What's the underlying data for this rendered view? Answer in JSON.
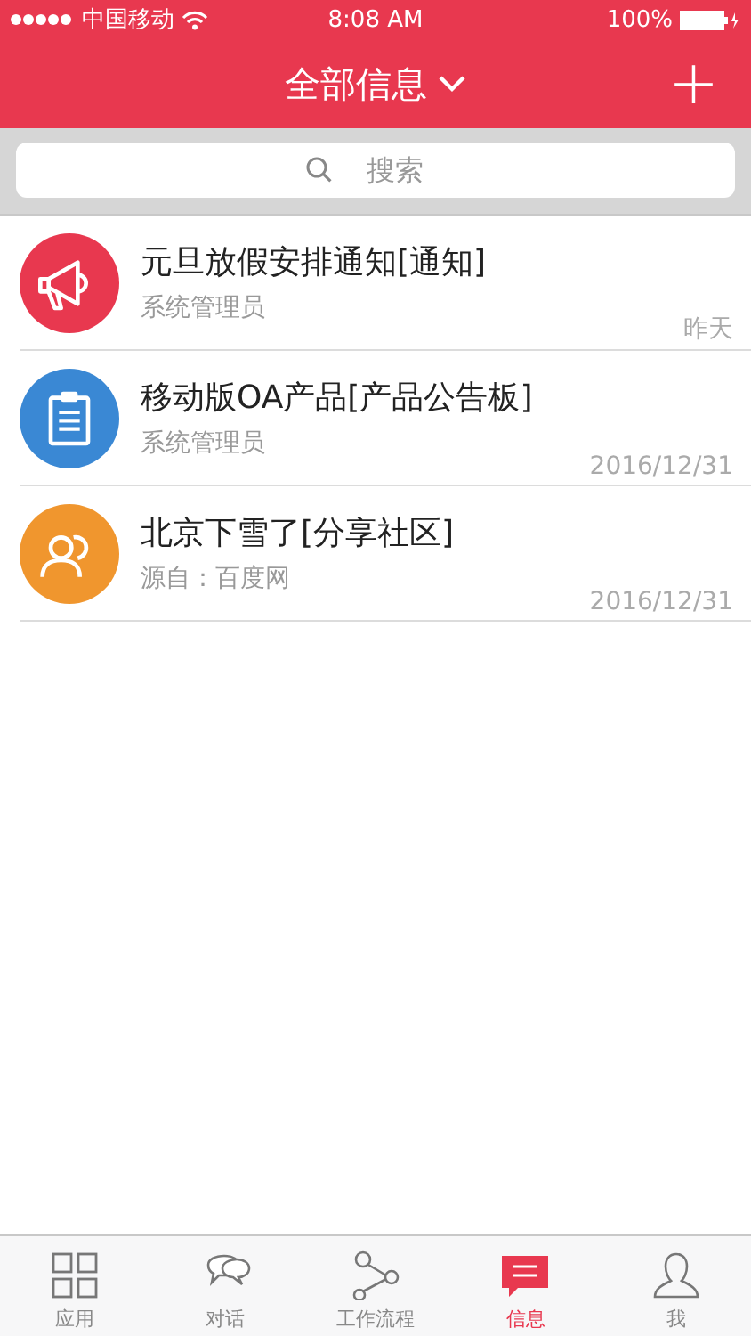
{
  "status_bar": {
    "carrier": "中国移动",
    "time": "8:08 AM",
    "battery": "100%"
  },
  "header": {
    "title": "全部信息",
    "add": "+"
  },
  "search": {
    "placeholder": "搜索"
  },
  "messages": [
    {
      "kind": "megaphone",
      "color": "#e8384f",
      "title": "元旦放假安排通知[通知]",
      "sender": "系统管理员",
      "date": "昨天"
    },
    {
      "kind": "clipboard",
      "color": "#3a88d4",
      "title": "移动版OA产品[产品公告板]",
      "sender": "系统管理员",
      "date": "2016/12/31"
    },
    {
      "kind": "people",
      "color": "#f0962e",
      "title": "北京下雪了[分享社区]",
      "sender": "源自：百度网",
      "date": "2016/12/31"
    }
  ],
  "tabs": [
    {
      "kind": "apps",
      "label": "应用",
      "selected": false
    },
    {
      "kind": "chat",
      "label": "对话",
      "selected": false
    },
    {
      "kind": "flow",
      "label": "工作流程",
      "selected": false
    },
    {
      "kind": "message",
      "label": "信息",
      "selected": true
    },
    {
      "kind": "user",
      "label": "我",
      "selected": false
    }
  ]
}
